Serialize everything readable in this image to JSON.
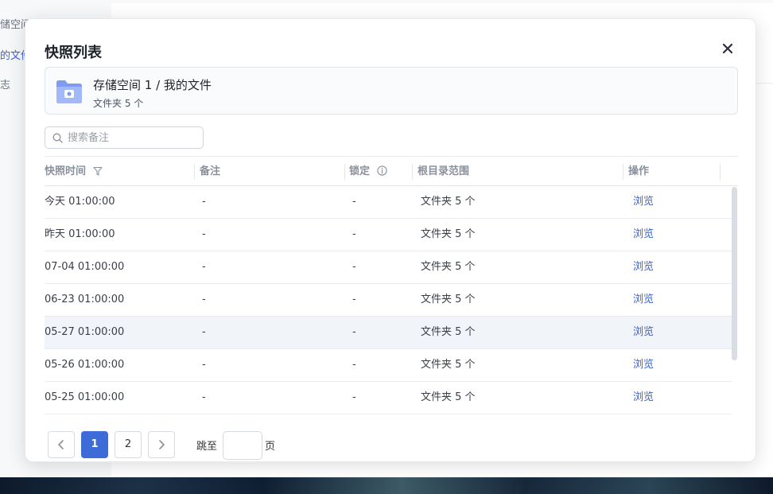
{
  "background": {
    "sidebar_items": [
      {
        "label": "储空间",
        "active": false
      },
      {
        "label": "的文件",
        "active": true
      },
      {
        "label": "志",
        "active": false
      }
    ]
  },
  "modal": {
    "title": "快照列表",
    "close_icon": "close-icon",
    "info": {
      "icon": "folder-camera-icon",
      "path": "存储空间 1 / 我的文件",
      "count": "文件夹 5 个"
    },
    "search": {
      "placeholder": "搜索备注",
      "value": ""
    },
    "table": {
      "columns": [
        {
          "label": "快照时间",
          "icon": "filter-icon"
        },
        {
          "label": "备注"
        },
        {
          "label": "锁定",
          "icon": "info-icon"
        },
        {
          "label": "根目录范围"
        },
        {
          "label": "操作"
        }
      ],
      "rows": [
        {
          "time": "今天 01:00:00",
          "note": "-",
          "lock": "-",
          "scope": "文件夹 5 个",
          "action": "浏览"
        },
        {
          "time": "昨天 01:00:00",
          "note": "-",
          "lock": "-",
          "scope": "文件夹 5 个",
          "action": "浏览"
        },
        {
          "time": "07-04 01:00:00",
          "note": "-",
          "lock": "-",
          "scope": "文件夹 5 个",
          "action": "浏览"
        },
        {
          "time": "06-23 01:00:00",
          "note": "-",
          "lock": "-",
          "scope": "文件夹 5 个",
          "action": "浏览"
        },
        {
          "time": "05-27 01:00:00",
          "note": "-",
          "lock": "-",
          "scope": "文件夹 5 个",
          "action": "浏览"
        },
        {
          "time": "05-26 01:00:00",
          "note": "-",
          "lock": "-",
          "scope": "文件夹 5 个",
          "action": "浏览"
        },
        {
          "time": "05-25 01:00:00",
          "note": "-",
          "lock": "-",
          "scope": "文件夹 5 个",
          "action": "浏览"
        }
      ]
    },
    "pagination": {
      "prev_icon": "chevron-left-icon",
      "pages": [
        "1",
        "2"
      ],
      "current": "1",
      "next_icon": "chevron-right-icon",
      "jump_label": "跳至",
      "jump_value": "",
      "page_suffix": "页"
    }
  },
  "colors": {
    "accent": "#3d6cd9",
    "link": "#3d63c8",
    "folder": "#6f8ef0"
  }
}
